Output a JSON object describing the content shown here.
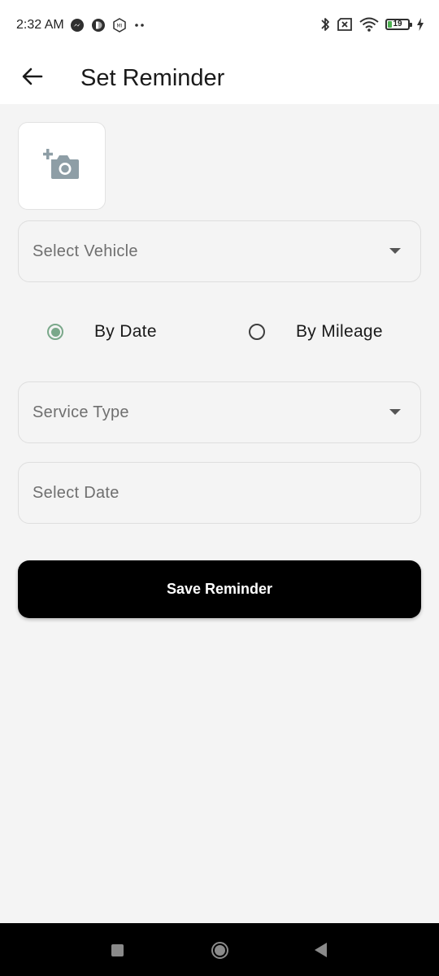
{
  "status_bar": {
    "time": "2:32 AM",
    "battery_level": "19",
    "battery_fraction": 0.19,
    "left_icons": [
      "messenger-icon",
      "app-notification-icon",
      "mi-app-icon",
      "more-dots-icon"
    ],
    "right_icons": [
      "bluetooth-icon",
      "no-sim-icon",
      "wifi-icon",
      "battery-icon",
      "charging-icon"
    ]
  },
  "app_bar": {
    "title": "Set Reminder",
    "back_icon": "arrow-back-icon"
  },
  "photo_picker": {
    "icon": "add-photo-camera-icon"
  },
  "form": {
    "vehicle": {
      "placeholder": "Select Vehicle"
    },
    "reminder_mode": {
      "options": [
        {
          "label": "By Date",
          "selected": true
        },
        {
          "label": "By Mileage",
          "selected": false
        }
      ]
    },
    "service_type": {
      "placeholder": "Service Type"
    },
    "date": {
      "placeholder": "Select Date"
    },
    "save_label": "Save Reminder"
  },
  "nav_bar": {
    "buttons": [
      "recents-square-icon",
      "home-circle-icon",
      "back-triangle-icon"
    ]
  },
  "colors": {
    "accent": "#7aa88a",
    "primary_button": "#000000",
    "background": "#f4f4f4",
    "icon_gray": "#8e9ea6"
  }
}
